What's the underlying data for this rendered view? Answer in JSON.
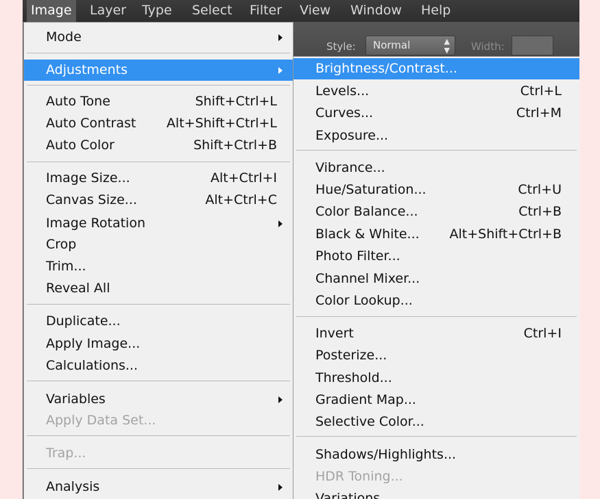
{
  "menubar": {
    "items": [
      {
        "label": "Image",
        "active": true
      },
      {
        "label": "Layer"
      },
      {
        "label": "Type"
      },
      {
        "label": "Select"
      },
      {
        "label": "Filter"
      },
      {
        "label": "View"
      },
      {
        "label": "Window"
      },
      {
        "label": "Help"
      }
    ]
  },
  "options_bar": {
    "style_label": "Style:",
    "style_value": "Normal",
    "width_label": "Width:"
  },
  "image_menu": {
    "items": [
      {
        "label": "Mode",
        "submenu": true
      },
      {
        "label": "Adjustments",
        "submenu": true,
        "highlighted": true
      },
      {
        "label": "Auto Tone",
        "shortcut": "Shift+Ctrl+L"
      },
      {
        "label": "Auto Contrast",
        "shortcut": "Alt+Shift+Ctrl+L"
      },
      {
        "label": "Auto Color",
        "shortcut": "Shift+Ctrl+B"
      },
      {
        "label": "Image Size...",
        "shortcut": "Alt+Ctrl+I"
      },
      {
        "label": "Canvas Size...",
        "shortcut": "Alt+Ctrl+C"
      },
      {
        "label": "Image Rotation",
        "submenu": true
      },
      {
        "label": "Crop"
      },
      {
        "label": "Trim..."
      },
      {
        "label": "Reveal All"
      },
      {
        "label": "Duplicate..."
      },
      {
        "label": "Apply Image..."
      },
      {
        "label": "Calculations..."
      },
      {
        "label": "Variables",
        "submenu": true
      },
      {
        "label": "Apply Data Set...",
        "disabled": true
      },
      {
        "label": "Trap...",
        "disabled": true
      },
      {
        "label": "Analysis",
        "submenu": true
      }
    ]
  },
  "adjustments_menu": {
    "items": [
      {
        "label": "Brightness/Contrast...",
        "highlighted": true
      },
      {
        "label": "Levels...",
        "shortcut": "Ctrl+L"
      },
      {
        "label": "Curves...",
        "shortcut": "Ctrl+M"
      },
      {
        "label": "Exposure..."
      },
      {
        "label": "Vibrance..."
      },
      {
        "label": "Hue/Saturation...",
        "shortcut": "Ctrl+U"
      },
      {
        "label": "Color Balance...",
        "shortcut": "Ctrl+B"
      },
      {
        "label": "Black & White...",
        "shortcut": "Alt+Shift+Ctrl+B"
      },
      {
        "label": "Photo Filter..."
      },
      {
        "label": "Channel Mixer..."
      },
      {
        "label": "Color Lookup..."
      },
      {
        "label": "Invert",
        "shortcut": "Ctrl+I"
      },
      {
        "label": "Posterize..."
      },
      {
        "label": "Threshold..."
      },
      {
        "label": "Gradient Map..."
      },
      {
        "label": "Selective Color..."
      },
      {
        "label": "Shadows/Highlights..."
      },
      {
        "label": "HDR Toning...",
        "disabled": true
      },
      {
        "label": "Variations..."
      }
    ]
  },
  "colors": {
    "highlight": "#3391f0",
    "menu_background": "#f0f0f0",
    "disabled_text": "#a3a3a3",
    "page_background": "#fde7e7"
  }
}
